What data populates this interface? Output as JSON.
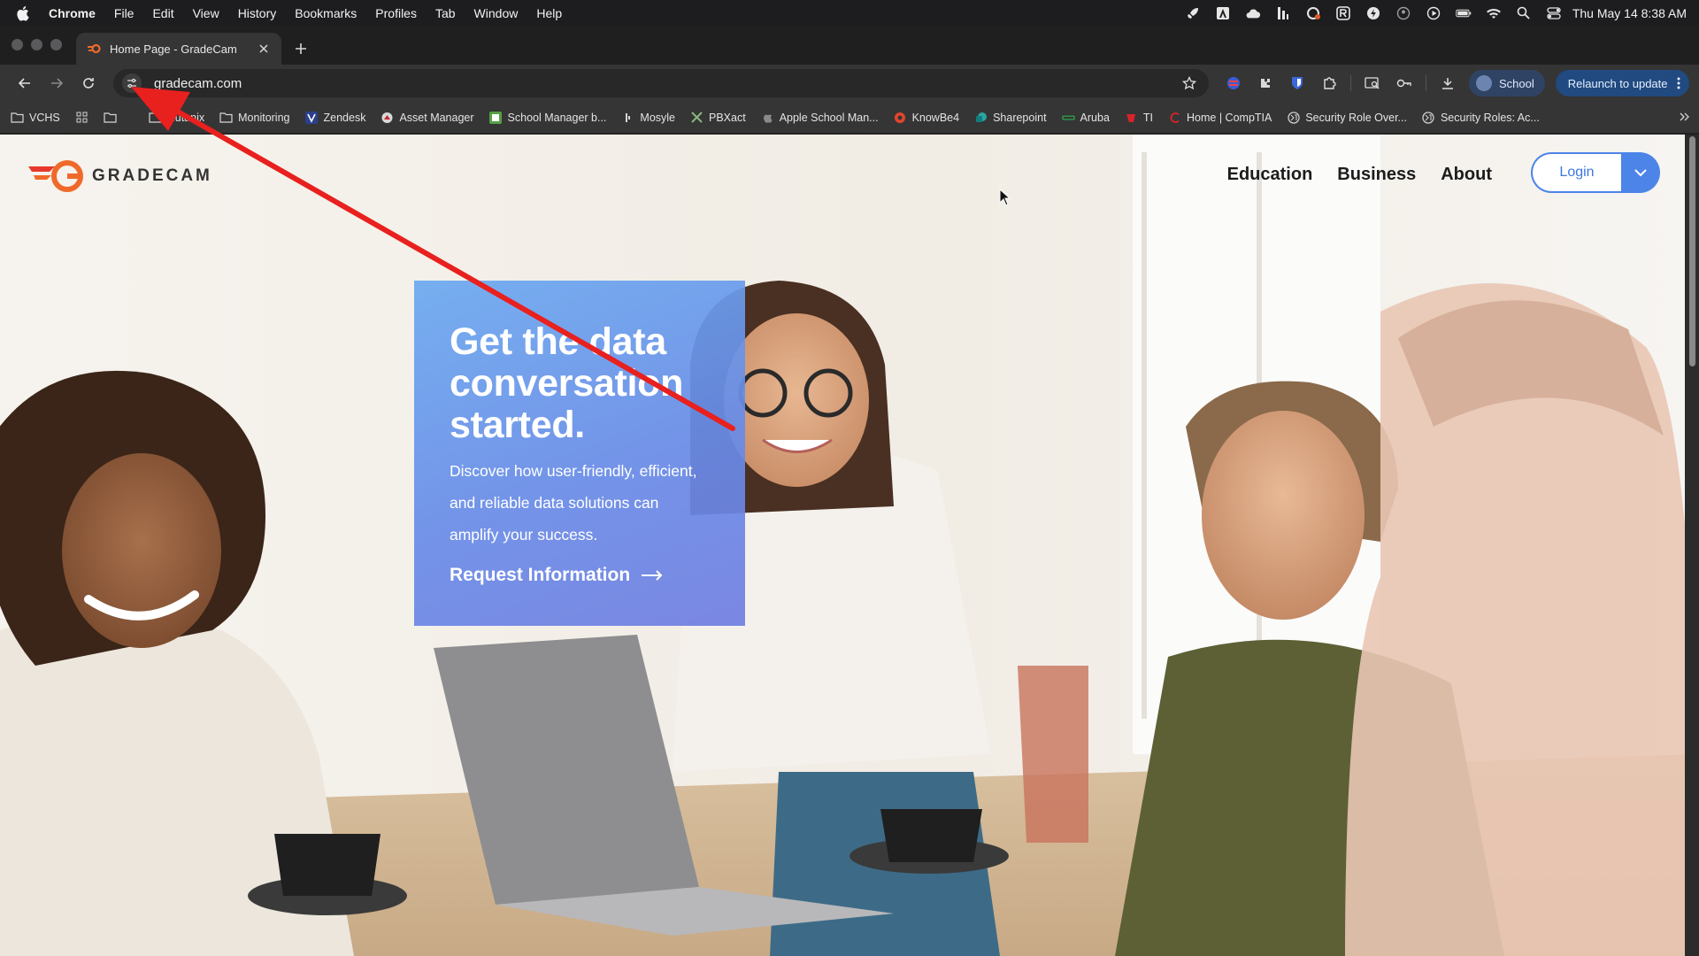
{
  "menubar": {
    "app": "Chrome",
    "items": [
      "File",
      "Edit",
      "View",
      "History",
      "Bookmarks",
      "Profiles",
      "Tab",
      "Window",
      "Help"
    ],
    "tray_icons": [
      "rocket-icon",
      "adobe-icon",
      "cloud-icon",
      "bars-icon",
      "sync-icon",
      "r-app-icon",
      "bolt-icon",
      "user-circle-icon",
      "play-icon",
      "battery-icon",
      "wifi-icon",
      "search-icon",
      "control-center-icon"
    ],
    "clock": "Thu May 14  8:38 AM"
  },
  "tab": {
    "title": "Home Page - GradeCam"
  },
  "toolbar": {
    "url": "gradecam.com",
    "profile_label": "School",
    "relaunch_label": "Relaunch to update"
  },
  "bookmarks": [
    {
      "label": "VCHS",
      "icon": "folder-icon"
    },
    {
      "label": "",
      "icon": "apps-grid-icon"
    },
    {
      "label": "",
      "icon": "folder-icon"
    },
    {
      "label": "Nutanix",
      "icon": "folder-icon"
    },
    {
      "label": "Monitoring",
      "icon": "folder-icon"
    },
    {
      "label": "Zendesk",
      "icon": "v-icon"
    },
    {
      "label": "Asset Manager",
      "icon": "asset-icon"
    },
    {
      "label": "School Manager b...",
      "icon": "school-manager-icon"
    },
    {
      "label": "Mosyle",
      "icon": "mosyle-icon"
    },
    {
      "label": "PBXact",
      "icon": "x-icon"
    },
    {
      "label": "Apple School Man...",
      "icon": "apple-icon"
    },
    {
      "label": "KnowBe4",
      "icon": "knowbe4-icon"
    },
    {
      "label": "Sharepoint",
      "icon": "sharepoint-icon"
    },
    {
      "label": "Aruba",
      "icon": "aruba-icon"
    },
    {
      "label": "TI",
      "icon": "ti-icon"
    },
    {
      "label": "Home | CompTIA",
      "icon": "comptia-icon"
    },
    {
      "label": "Security Role Over...",
      "icon": "globe-icon"
    },
    {
      "label": "Security Roles: Ac...",
      "icon": "globe-icon"
    }
  ],
  "site": {
    "logo_text": "GRADECAM",
    "nav": [
      "Education",
      "Business",
      "About"
    ],
    "login_label": "Login",
    "hero": {
      "title_lines": [
        "Get the data",
        "conversation",
        "started."
      ],
      "body_lines": [
        "Discover how user-friendly, efficient,",
        "and reliable data solutions can",
        "amplify your success."
      ],
      "cta": "Request Information"
    }
  },
  "colors": {
    "accent_blue": "#4d84e8",
    "annotation_red": "#e8201e",
    "logo_orange": "#ef6a2a"
  }
}
